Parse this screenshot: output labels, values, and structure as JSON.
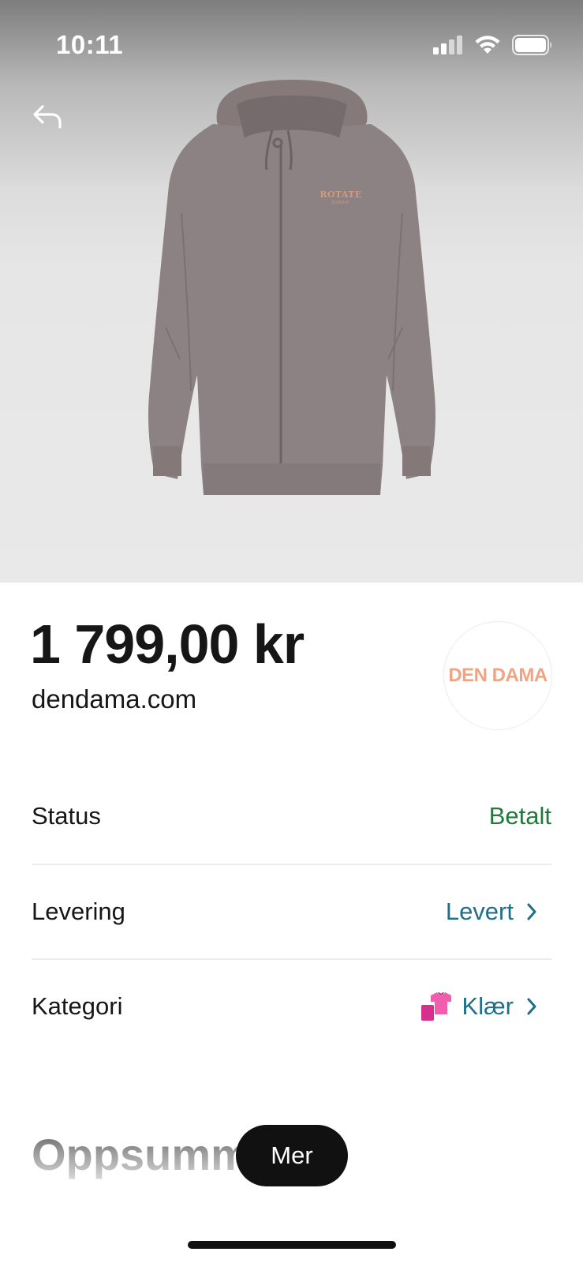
{
  "status_bar": {
    "time": "10:11"
  },
  "product": {
    "image_icon": "hoodie-image",
    "brand_print": "ROTATE",
    "brand_print_sub": "SUNDAY",
    "price": "1 799,00 kr",
    "store": "dendama.com",
    "store_logo_text": "DEN DAMA"
  },
  "details": {
    "status": {
      "label": "Status",
      "value": "Betalt"
    },
    "delivery": {
      "label": "Levering",
      "value": "Levert"
    },
    "category": {
      "label": "Kategori",
      "value": "Klær",
      "icon": "shirt-icon"
    }
  },
  "summary": {
    "heading": "Oppsumm"
  },
  "actions": {
    "more_label": "Mer"
  },
  "colors": {
    "status_paid": "#1f7a3c",
    "link_blue": "#1f6f8b",
    "store_logo": "#f0a483",
    "button_bg": "#111111"
  }
}
